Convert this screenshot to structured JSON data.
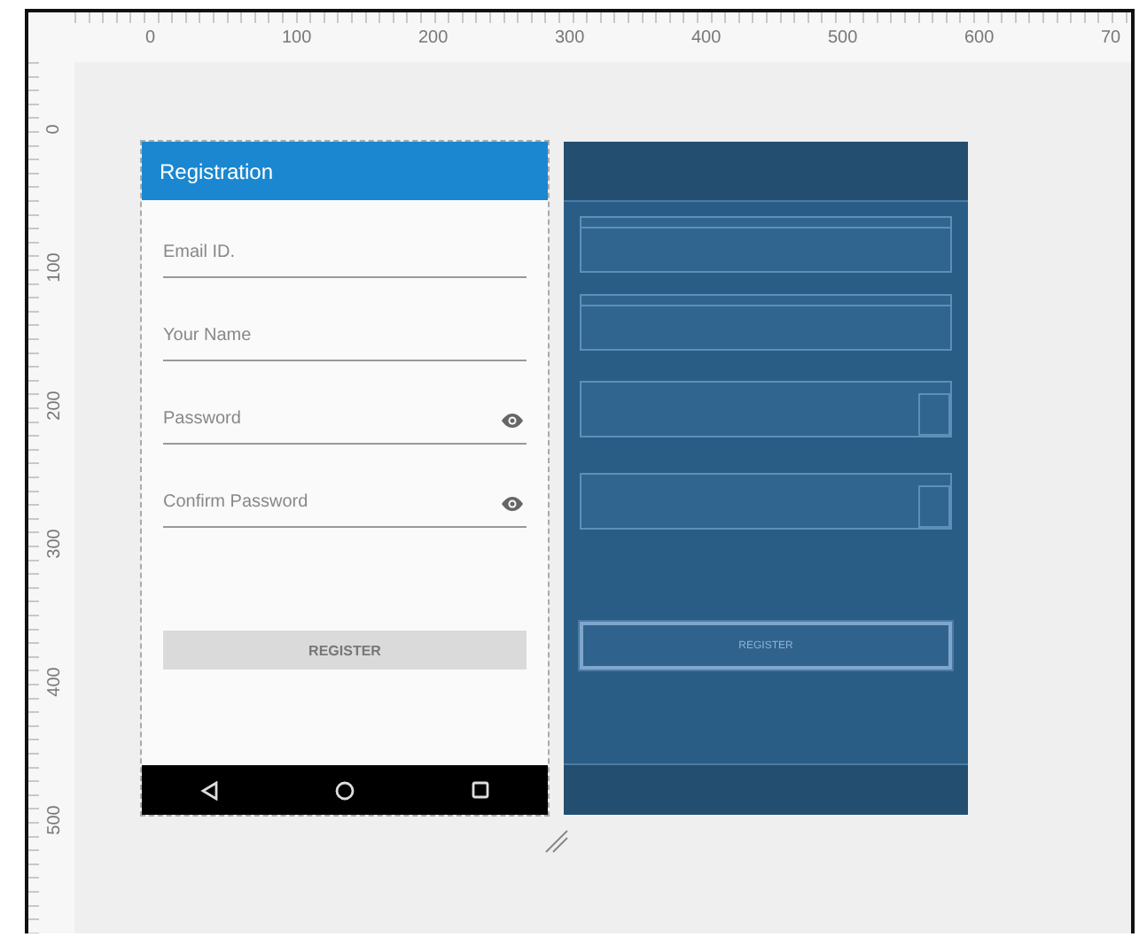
{
  "rulers": {
    "horizontal": [
      "0",
      "100",
      "200",
      "300",
      "400",
      "500",
      "600",
      "70"
    ],
    "vertical": [
      "0",
      "100",
      "200",
      "300",
      "400",
      "500"
    ]
  },
  "design": {
    "app_bar_title": "Registration",
    "fields": [
      {
        "placeholder": "Email ID.",
        "kind": "text"
      },
      {
        "placeholder": "Your Name",
        "kind": "text"
      },
      {
        "placeholder": "Password",
        "kind": "password"
      },
      {
        "placeholder": "Confirm Password",
        "kind": "password"
      }
    ],
    "button": "REGISTER"
  },
  "blueprint": {
    "button": "REGISTER"
  }
}
